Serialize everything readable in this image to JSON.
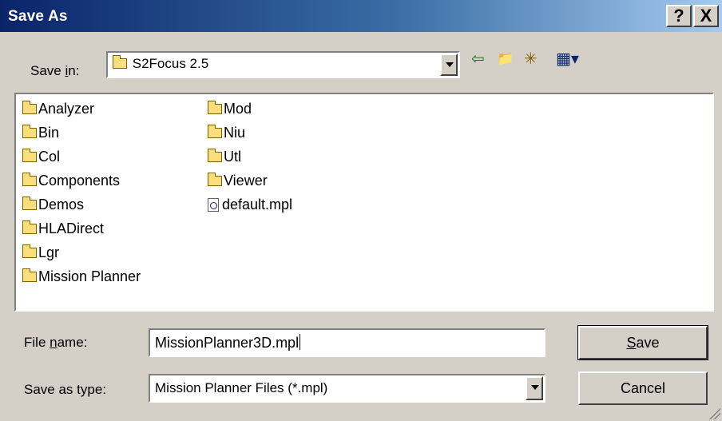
{
  "window": {
    "title": "Save As",
    "help_glyph": "?",
    "close_glyph": "X"
  },
  "save_in": {
    "label_pre": "Save ",
    "label_key": "i",
    "label_post": "n:",
    "value": "S2Focus 2.5",
    "icon": "folder-open-icon"
  },
  "toolbar": {
    "back_glyph": "⇦",
    "up_glyph": "📁",
    "new_folder_glyph": "✳",
    "views_glyph": "▦▾"
  },
  "items": [
    {
      "name": "Analyzer",
      "type": "folder"
    },
    {
      "name": "Bin",
      "type": "folder"
    },
    {
      "name": "Col",
      "type": "folder"
    },
    {
      "name": "Components",
      "type": "folder"
    },
    {
      "name": "Demos",
      "type": "folder"
    },
    {
      "name": "HLADirect",
      "type": "folder"
    },
    {
      "name": "Lgr",
      "type": "folder"
    },
    {
      "name": "Mission Planner",
      "type": "folder"
    },
    {
      "name": "Mod",
      "type": "folder"
    },
    {
      "name": "Niu",
      "type": "folder"
    },
    {
      "name": "Utl",
      "type": "folder"
    },
    {
      "name": "Viewer",
      "type": "folder"
    },
    {
      "name": "default.mpl",
      "type": "file"
    }
  ],
  "file_name": {
    "label_pre": "File ",
    "label_key": "n",
    "label_post": "ame:",
    "value": "MissionPlanner3D.mpl"
  },
  "save_type": {
    "label": "Save as type:",
    "value": "Mission Planner Files (*.mpl)"
  },
  "buttons": {
    "save_key": "S",
    "save_rest": "ave",
    "cancel": "Cancel"
  },
  "colors": {
    "title_start": "#0a246a",
    "title_end": "#a6caf0",
    "face": "#d4d0c8"
  }
}
